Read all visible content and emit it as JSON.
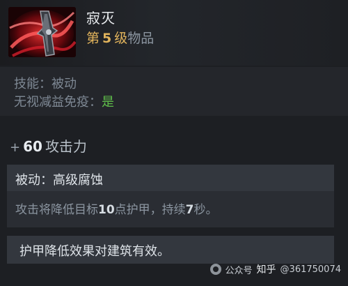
{
  "item": {
    "name": "寂灭",
    "level_prefix": "第",
    "level_number": "5",
    "level_suffix": "级",
    "level_tail": "物品",
    "icon": "desolator-icon"
  },
  "properties": {
    "skill_label": "技能：",
    "skill_value": "被动",
    "bkb_label": "无视减益免疫：",
    "bkb_value": "是"
  },
  "attribute": {
    "sign": "+",
    "value": "60",
    "name": "攻击力"
  },
  "passive": {
    "title": "被动：高级腐蚀",
    "desc_pre": "攻击将降低目标",
    "desc_num1": "10",
    "desc_mid": "点护甲，持续",
    "desc_num2": "7",
    "desc_post": "秒。"
  },
  "note": "护甲降低效果对建筑有效。",
  "watermark": {
    "source": "公众号",
    "zhihu": "知乎",
    "user": "@361750074"
  },
  "colors": {
    "gold": "#e1b35c",
    "green": "#5fbe4a",
    "muted": "#7e8894"
  }
}
